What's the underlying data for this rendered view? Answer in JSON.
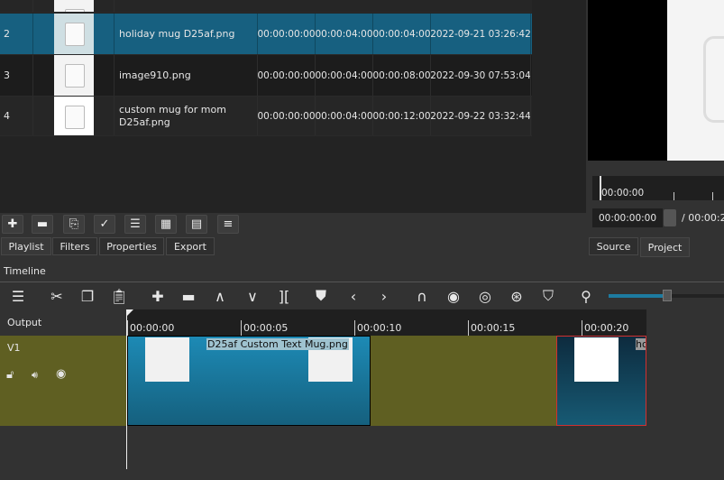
{
  "playlist": {
    "rows": [
      {
        "num": "2",
        "name": "holiday mug D25af.png",
        "in": "00:00:00:00",
        "duration": "00:00:04:00",
        "start": "00:00:04:00",
        "date": "2022-09-21 03:26:42",
        "selected": true
      },
      {
        "num": "3",
        "name": "image910.png",
        "in": "00:00:00:00",
        "duration": "00:00:04:00",
        "start": "00:00:08:00",
        "date": "2022-09-30 07:53:04"
      },
      {
        "num": "4",
        "name": "custom mug for mom D25af.png",
        "in": "00:00:00:00",
        "duration": "00:00:04:00",
        "start": "00:00:12:00",
        "date": "2022-09-22 03:32:44"
      }
    ],
    "toolbar": [
      "plus-icon",
      "minus-icon",
      "update-icon",
      "check-icon",
      "list-view-icon",
      "grid-view-icon",
      "details-view-icon",
      "menu-icon"
    ],
    "tabs": [
      "Playlist",
      "Filters",
      "Properties",
      "Export"
    ]
  },
  "viewer": {
    "ruler_label": "00:00:00",
    "timecode": "00:00:00:00",
    "duration": "/ 00:00:2",
    "tabs": [
      "Source",
      "Project"
    ]
  },
  "timeline": {
    "title": "Timeline",
    "output_label": "Output",
    "track_name": "V1",
    "ticks": [
      "00:00:00",
      "00:00:05",
      "00:00:10",
      "00:00:15",
      "00:00:20"
    ],
    "clips": [
      {
        "name": "D25af Custom Text Mug.png"
      },
      {
        "name": "ho"
      }
    ],
    "zoom_level": 0.85,
    "colors": {
      "track": "#5f5f22",
      "clip": "#1d7ba0",
      "selected_clip_border": "#d03030"
    }
  }
}
